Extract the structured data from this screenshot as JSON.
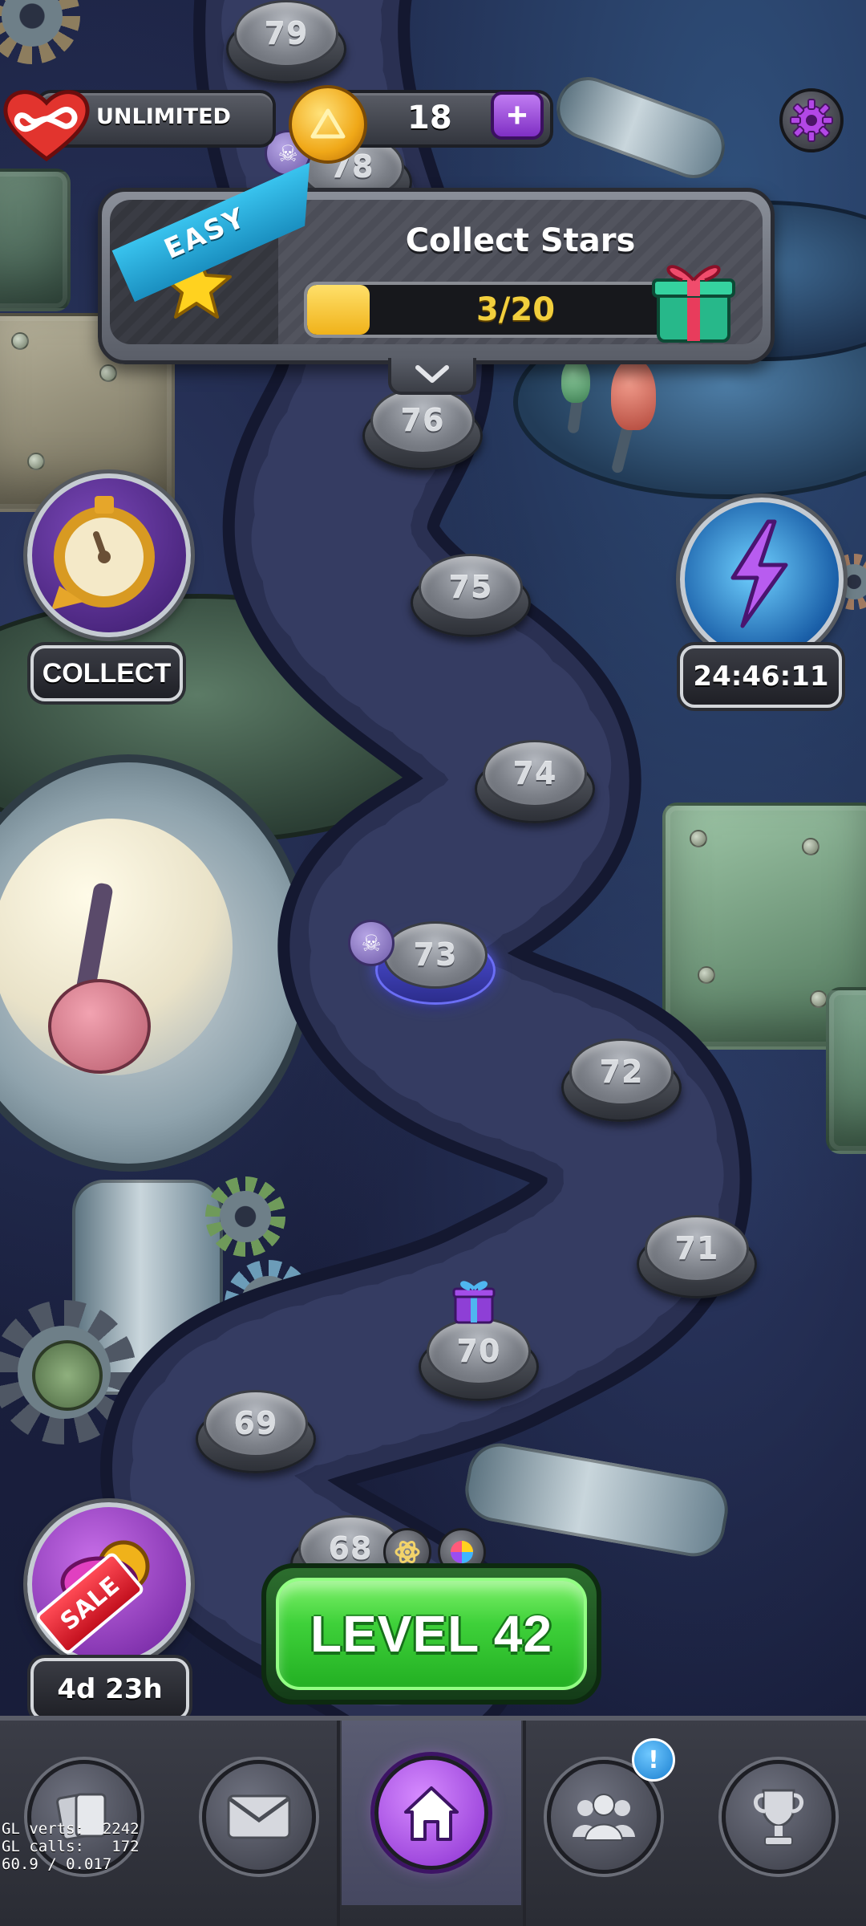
{
  "hud": {
    "lives_label": "UNLIMITED",
    "coins": "18",
    "plus": "+",
    "settings_icon": "gear-icon"
  },
  "quest": {
    "difficulty": "EASY",
    "title": "Collect Stars",
    "progress_text": "3/20",
    "progress_current": 3,
    "progress_total": 20,
    "reward_icon": "gift-icon"
  },
  "side_buttons": {
    "collect_label": "COLLECT",
    "timer": "24:46:11",
    "sale_badge": "SALE",
    "sale_timer": "4d 23h"
  },
  "levels": [
    "79",
    "78",
    "76",
    "75",
    "74",
    "73",
    "72",
    "71",
    "70",
    "69",
    "68"
  ],
  "play_button": "LEVEL 42",
  "nav": {
    "items": [
      {
        "name": "cards",
        "icon": "cards-icon"
      },
      {
        "name": "mail",
        "icon": "mail-icon"
      },
      {
        "name": "home",
        "icon": "home-icon",
        "active": true
      },
      {
        "name": "team",
        "icon": "team-icon",
        "badge": "!"
      },
      {
        "name": "leaderboard",
        "icon": "trophy-icon"
      }
    ]
  },
  "debug": {
    "line1": "GL verts:  2242",
    "line2": "GL calls:   172",
    "line3": "60.9 / 0.017"
  },
  "colors": {
    "accent_purple": "#8a2fd0",
    "play_green": "#3fd13a",
    "progress_yellow": "#f0b21a",
    "ribbon_blue": "#1a8fc0"
  }
}
